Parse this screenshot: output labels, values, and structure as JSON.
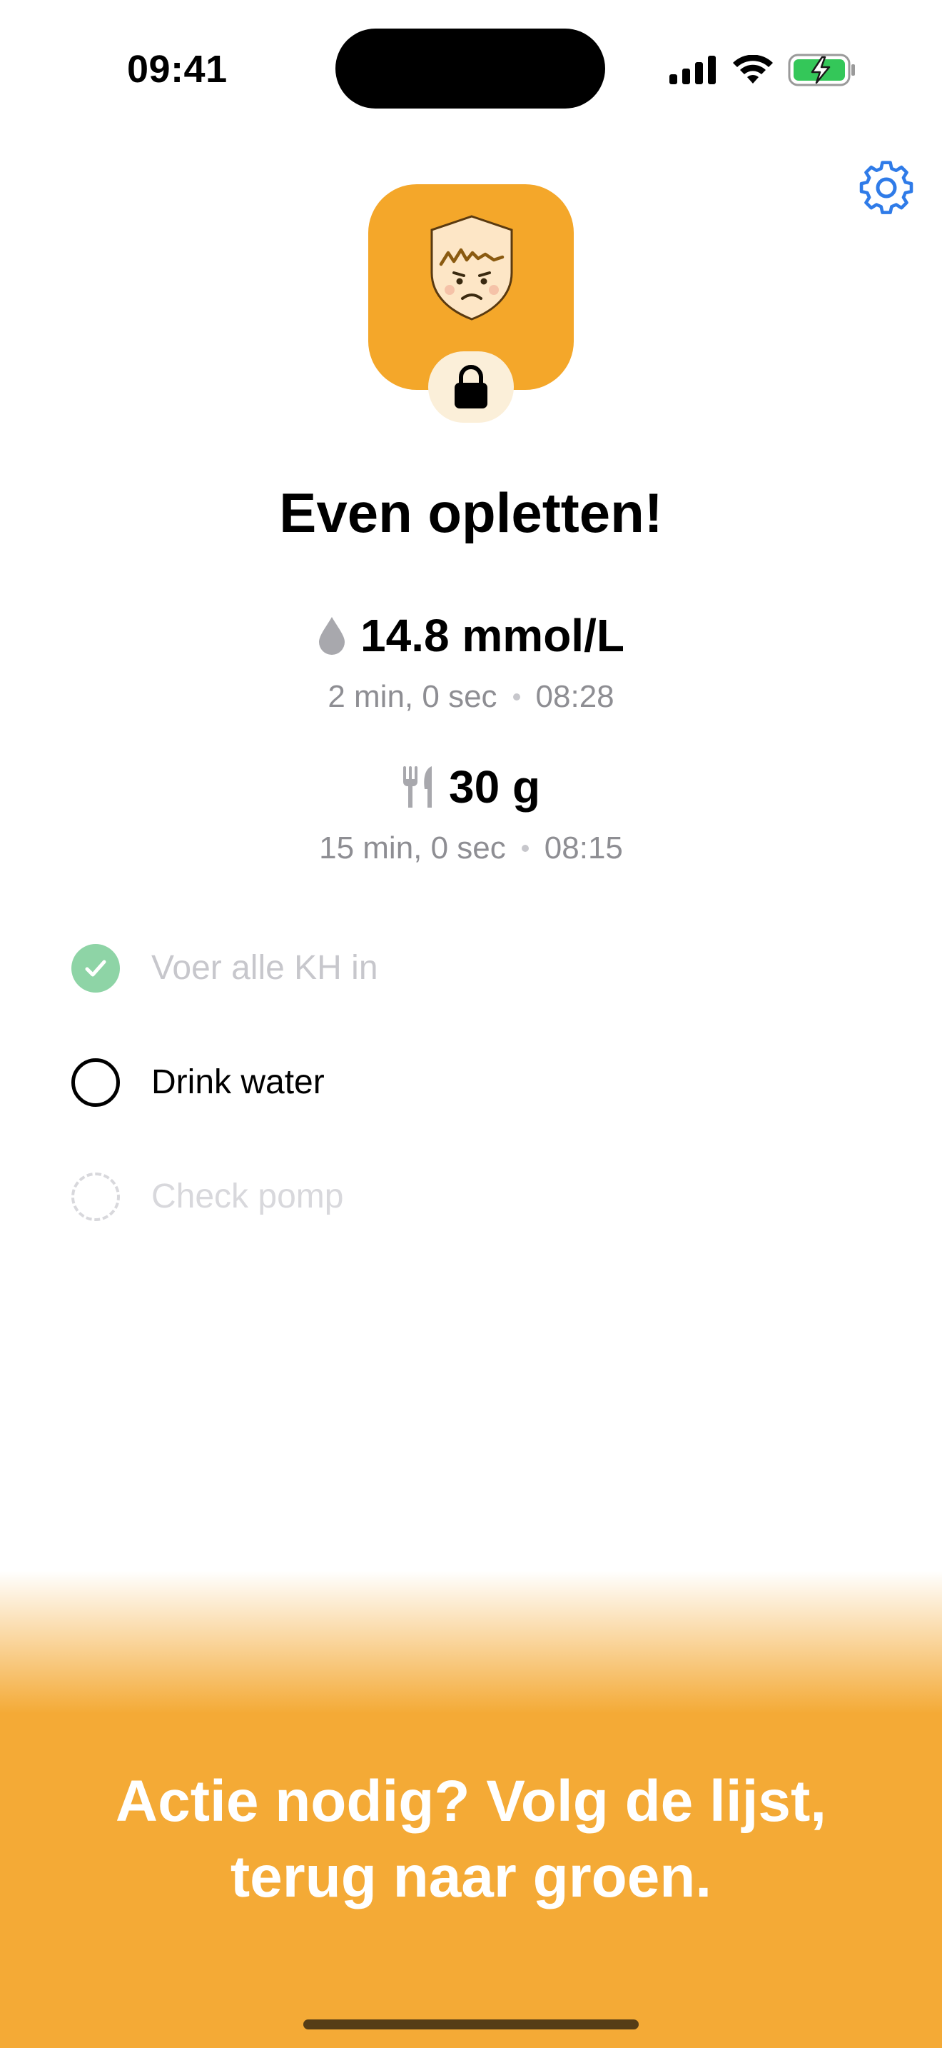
{
  "status_bar": {
    "time": "09:41"
  },
  "header": {
    "settings_icon": "gear-icon"
  },
  "app_icon": {
    "mascot": "worried-shield-face",
    "badge_icon": "lock-icon",
    "background_color": "#f4a72a"
  },
  "title": "Even opletten!",
  "glucose": {
    "icon": "drop-icon",
    "value": "14.8 mmol/L",
    "age": "2 min, 0 sec",
    "time": "08:28"
  },
  "carbs": {
    "icon": "fork-knife-icon",
    "value": "30 g",
    "age": "15 min, 0 sec",
    "time": "08:15"
  },
  "checklist": [
    {
      "label": "Voer alle KH in",
      "state": "done"
    },
    {
      "label": "Drink water",
      "state": "active"
    },
    {
      "label": "Check pomp",
      "state": "pending"
    }
  ],
  "banner": {
    "line1": "Actie nodig? Volg de lijst,",
    "line2": "terug naar groen.",
    "color": "#f4aa36"
  }
}
